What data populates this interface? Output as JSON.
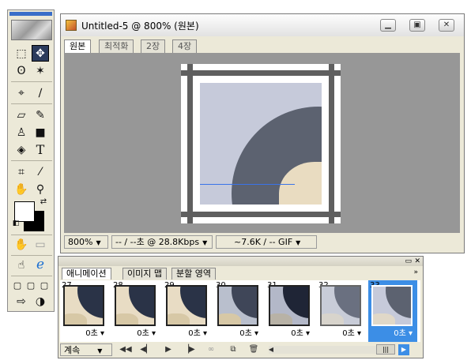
{
  "toolbox": {
    "tools": [
      {
        "id": "marquee",
        "glyph": "⬚"
      },
      {
        "id": "move",
        "glyph": "✥"
      },
      {
        "id": "lasso",
        "glyph": "ʘ"
      },
      {
        "id": "magic-wand",
        "glyph": "✶"
      },
      {
        "id": "slice-select",
        "glyph": "⌖"
      },
      {
        "id": "slice",
        "glyph": "∕"
      },
      {
        "id": "eraser",
        "glyph": "▱"
      },
      {
        "id": "pencil",
        "glyph": "✎"
      },
      {
        "id": "stamp",
        "glyph": "♙"
      },
      {
        "id": "shape",
        "glyph": "■"
      },
      {
        "id": "bucket",
        "glyph": "◈"
      },
      {
        "id": "type",
        "glyph": "T"
      },
      {
        "id": "crop",
        "glyph": "⌗"
      },
      {
        "id": "eyedropper",
        "glyph": "⁄"
      },
      {
        "id": "hand",
        "glyph": "✋"
      },
      {
        "id": "zoom",
        "glyph": "⚲"
      },
      {
        "id": "hand-alt",
        "glyph": "✋"
      },
      {
        "id": "slice-vis",
        "glyph": "▭"
      },
      {
        "id": "hand-edit",
        "glyph": "☝"
      },
      {
        "id": "ie",
        "glyph": "ℯ"
      },
      {
        "id": "mode1",
        "glyph": "▢"
      },
      {
        "id": "mode2",
        "glyph": "▢"
      },
      {
        "id": "mode3",
        "glyph": "▢"
      },
      {
        "id": "jump",
        "glyph": "⇨"
      },
      {
        "id": "jump2",
        "glyph": "◑"
      }
    ]
  },
  "document": {
    "title": "Untitled-5 @ 800% (원본)",
    "tabs": [
      "원본",
      "최적화",
      "2장",
      "4장"
    ],
    "status": {
      "zoom": "800%",
      "download": "-- / --초 @ 28.8Kbps",
      "size": "~7.6K / -- GIF"
    }
  },
  "animation": {
    "tabs": [
      "애니메이션",
      "이미지 맵",
      "분할 영역"
    ],
    "frames": [
      {
        "num": "27",
        "delay": "0초"
      },
      {
        "num": "28",
        "delay": "0초"
      },
      {
        "num": "29",
        "delay": "0초"
      },
      {
        "num": "30",
        "delay": "0초"
      },
      {
        "num": "31",
        "delay": "0초"
      },
      {
        "num": "32",
        "delay": "0초"
      },
      {
        "num": "33",
        "delay": "0초"
      }
    ],
    "selected_frame": "33",
    "loop": "계속"
  },
  "colors": {
    "accent": "#3c8ee6",
    "canvas_bg": "#979797",
    "panel_bg": "#ece9d8"
  }
}
